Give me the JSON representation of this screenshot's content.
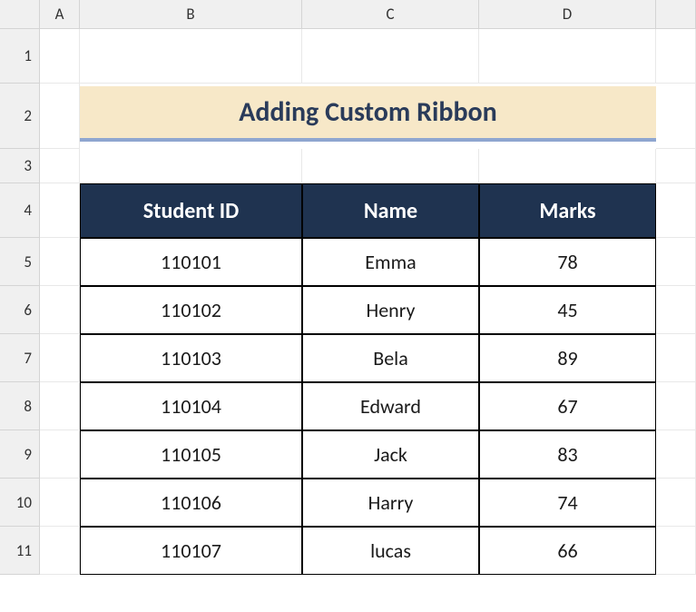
{
  "columns": [
    "A",
    "B",
    "C",
    "D"
  ],
  "rows": [
    "1",
    "2",
    "3",
    "4",
    "5",
    "6",
    "7",
    "8",
    "9",
    "10",
    "11"
  ],
  "title": "Adding Custom Ribbon",
  "table": {
    "headers": [
      "Student ID",
      "Name",
      "Marks"
    ],
    "data": [
      {
        "id": "110101",
        "name": "Emma",
        "marks": "78"
      },
      {
        "id": "110102",
        "name": "Henry",
        "marks": "45"
      },
      {
        "id": "110103",
        "name": "Bela",
        "marks": "89"
      },
      {
        "id": "110104",
        "name": "Edward",
        "marks": "67"
      },
      {
        "id": "110105",
        "name": "Jack",
        "marks": "83"
      },
      {
        "id": "110106",
        "name": "Harry",
        "marks": "74"
      },
      {
        "id": "110107",
        "name": "lucas",
        "marks": "66"
      }
    ]
  }
}
